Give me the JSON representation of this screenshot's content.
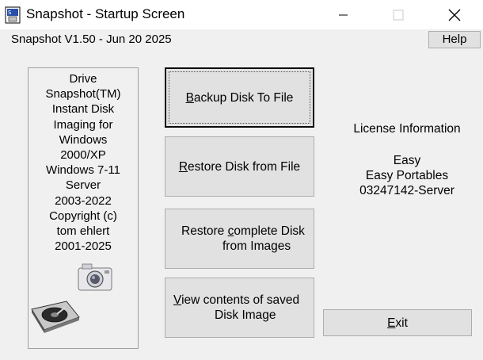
{
  "window": {
    "title": "Snapshot - Startup Screen",
    "controls": [
      "minimize",
      "maximize",
      "close"
    ]
  },
  "header": {
    "version": "Snapshot V1.50 - Jun 20 2025",
    "help_label": "Help"
  },
  "info_panel": {
    "lines": [
      "Drive",
      "Snapshot(TM)",
      "Instant Disk",
      "Imaging for",
      "Windows",
      "2000/XP",
      "Windows 7-11",
      "Server",
      "2003-2022",
      "Copyright (c)",
      "tom ehlert",
      " 2001-2025"
    ],
    "images": [
      "camera-image",
      "hard-disk-image"
    ]
  },
  "actions": {
    "backup": {
      "accel": "B",
      "rest": "ackup Disk To File"
    },
    "restore": {
      "accel": "R",
      "rest": "estore Disk from File"
    },
    "restore_complete": {
      "line1_pre": "Restore ",
      "accel": "c",
      "line1_post": "omplete Disk",
      "line2": "from Images"
    },
    "view": {
      "accel": "V",
      "line1_rest": "iew contents of saved",
      "line2": "Disk Image"
    },
    "exit": {
      "accel": "E",
      "rest": "xit"
    }
  },
  "license": {
    "title": "License Information",
    "name": "Easy",
    "company": "Easy Portables",
    "key": "03247142-Server"
  },
  "colors": {
    "window_bg": "#f0f0f0",
    "button_bg": "#e1e1e1",
    "button_border": "#adadad",
    "titlebar_bg": "#ffffff"
  }
}
